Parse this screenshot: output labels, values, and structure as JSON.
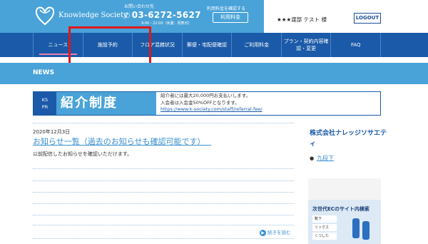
{
  "header": {
    "logo_text": "Knowledge Society",
    "contact_label": "お問い合わせ先",
    "phone": "03-6272-5627",
    "hours": "9:00 - 22:00（休業：祝祭日）",
    "check_label": "利用料金を確認する",
    "check_button": "利用料金",
    "user_name": "★★★渡部 テスト 様",
    "logout_button": "LOGOUT"
  },
  "nav": {
    "items": [
      {
        "label": "ニュース"
      },
      {
        "label": "施設予約"
      },
      {
        "label": "フロア混雑状況"
      },
      {
        "label": "郵便・宅配便確認"
      },
      {
        "label": "ご利用料金"
      },
      {
        "label": "プラン・契約内容確\n認・変更"
      },
      {
        "label": "FAQ"
      }
    ],
    "active_index": 0
  },
  "section": {
    "title": "NEWS"
  },
  "banner": {
    "ks": "KS",
    "pr": "PR",
    "big_text": "紹介制度",
    "line1": "紹介者には最大20,000円お支払いします。",
    "line2": "入会者は入会金50%OFFとなります。",
    "link": "https://www.k-society.com/staff/referral-fee/"
  },
  "article": {
    "date": "2020年12月3日",
    "title": "お知らせ一覧（過去のお知らせも確認可能です）",
    "body": "以前配信したお知らせを確認いただけます。",
    "read_more": "続きを読む"
  },
  "sidebar": {
    "heading": "株式会社ナレッジソサエティ",
    "links": [
      {
        "label": "九段下"
      }
    ]
  },
  "ad": {
    "title": "次世代ECのサイト内検索",
    "chips": [
      "靴下",
      "ソックス",
      "くつした"
    ]
  },
  "colors": {
    "header_blue": "#4aa3d8",
    "nav_blue": "#1a5aa8",
    "highlight_red": "#e01818",
    "link_blue": "#3a8fd0"
  }
}
